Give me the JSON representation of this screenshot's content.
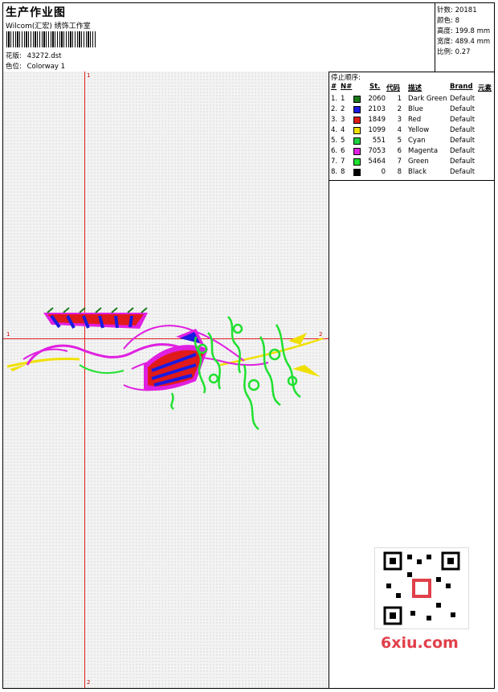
{
  "header": {
    "title": "生产作业图",
    "subtitle": "Wilcom(汇宏) 绣饰工作室",
    "design_label": "花版:",
    "design_value": "43272.dst",
    "colorway_label": "色位:",
    "colorway_value": "Colorway 1"
  },
  "stats": [
    {
      "label": "针数:",
      "value": "20181"
    },
    {
      "label": "颜色:",
      "value": "8"
    },
    {
      "label": "高度:",
      "value": "199.8 mm"
    },
    {
      "label": "宽度:",
      "value": "489.4 mm"
    },
    {
      "label": "比例:",
      "value": "0.27"
    }
  ],
  "stop_sequence": {
    "title": "停止顺序:",
    "columns": {
      "num": "#",
      "no": "N#",
      "stitches": "St.",
      "code": "代码",
      "desc": "描述",
      "brand": "Brand",
      "elem": "元素"
    },
    "rows": [
      {
        "num": "1.",
        "no": "1",
        "color": "#1a7a1a",
        "stitches": "2060",
        "code": "1",
        "desc": "Dark Green",
        "brand": "Default"
      },
      {
        "num": "2.",
        "no": "2",
        "color": "#1a1ae0",
        "stitches": "2103",
        "code": "2",
        "desc": "Blue",
        "brand": "Default"
      },
      {
        "num": "3.",
        "no": "3",
        "color": "#e01a1a",
        "stitches": "1849",
        "code": "3",
        "desc": "Red",
        "brand": "Default"
      },
      {
        "num": "4.",
        "no": "4",
        "color": "#f0e000",
        "stitches": "1099",
        "code": "4",
        "desc": "Yellow",
        "brand": "Default"
      },
      {
        "num": "5.",
        "no": "5",
        "color": "#20d040",
        "stitches": "551",
        "code": "5",
        "desc": "Cyan",
        "brand": "Default"
      },
      {
        "num": "6.",
        "no": "6",
        "color": "#e020e0",
        "stitches": "7053",
        "code": "6",
        "desc": "Magenta",
        "brand": "Default"
      },
      {
        "num": "7.",
        "no": "7",
        "color": "#20e030",
        "stitches": "5464",
        "code": "7",
        "desc": "Green",
        "brand": "Default"
      },
      {
        "num": "8.",
        "no": "8",
        "color": "#000000",
        "stitches": "0",
        "code": "8",
        "desc": "Black",
        "brand": "Default"
      }
    ]
  },
  "axis_labels": {
    "v_top": "1",
    "v_bottom": "2",
    "h_left": "1",
    "h_right": "2"
  },
  "watermark": "6xiu.com",
  "colors": {
    "axis": "#e02020",
    "magenta": "#e020e0",
    "green": "#20e030",
    "yellow": "#f0e000",
    "red": "#e01a1a",
    "blue": "#1a1ae0"
  }
}
